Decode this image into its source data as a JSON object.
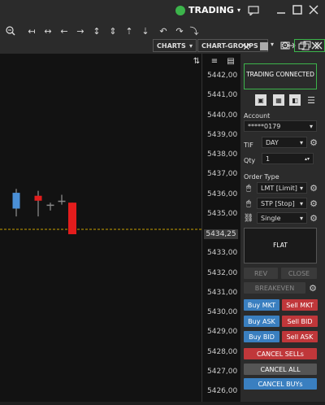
{
  "titlebar": {
    "status_label": "TRADING",
    "status_color": "#3cb44b"
  },
  "toolbar": {
    "buttons": [
      "zoom-out",
      "step-back-far",
      "fit",
      "step-back",
      "step-forward",
      "expand",
      "compress",
      "up-step",
      "down-step",
      "undo",
      "redo"
    ]
  },
  "subbar": {
    "charts_label": "CHARTS",
    "chart_groups_label": "CHART-GROUPS"
  },
  "axis": {
    "ticks": [
      "5442,00",
      "5441,00",
      "5440,00",
      "5439,00",
      "5438,00",
      "5437,00",
      "5436,00",
      "5435,00",
      "5434,00",
      "5433,00",
      "5432,00",
      "5431,00",
      "5430,00",
      "5429,00",
      "5428,00",
      "5427,00",
      "5426,00"
    ],
    "last_price": "5434,25"
  },
  "chart_data": {
    "type": "candlestick",
    "candles": [
      {
        "open": 5435.3,
        "close": 5436.1,
        "high": 5436.3,
        "low": 5434.9,
        "color": "#4a8fd6"
      },
      {
        "open": 5435.95,
        "close": 5435.7,
        "high": 5436.2,
        "low": 5434.9,
        "color": "#e31c1c"
      },
      {
        "open": 5435.5,
        "close": 5435.5,
        "high": 5435.6,
        "low": 5435.2,
        "color": "#888888"
      },
      {
        "open": 5435.7,
        "close": 5435.7,
        "high": 5436.0,
        "low": 5435.5,
        "color": "#888888"
      },
      {
        "open": 5435.6,
        "close": 5434.0,
        "high": 5435.6,
        "low": 5434.0,
        "color": "#e31c1c"
      }
    ],
    "last_price": 5434.25,
    "ymin": 5426,
    "ymax": 5442
  },
  "panel": {
    "status": "TRADING CONNECTED",
    "account_label": "Account",
    "account_value": "*****0179",
    "tif_label": "TIF",
    "tif_value": "DAY",
    "qty_label": "Qty",
    "qty_value": "1",
    "order_type_label": "Order Type",
    "order_types": [
      "LMT [Limit]",
      "STP [Stop]",
      "Single"
    ],
    "position": "FLAT",
    "rev": "REV",
    "close": "CLOSE",
    "breakeven": "BREAKEVEN",
    "buy_mkt": "Buy MKT",
    "sell_mkt": "Sell MKT",
    "buy_ask": "Buy ASK",
    "sell_bid": "Sell BID",
    "buy_bid": "Buy BID",
    "sell_ask": "Sell ASK",
    "cancel_sells": "CANCEL SELLs",
    "cancel_all": "CANCEL ALL",
    "cancel_buys": "CANCEL BUYs"
  }
}
